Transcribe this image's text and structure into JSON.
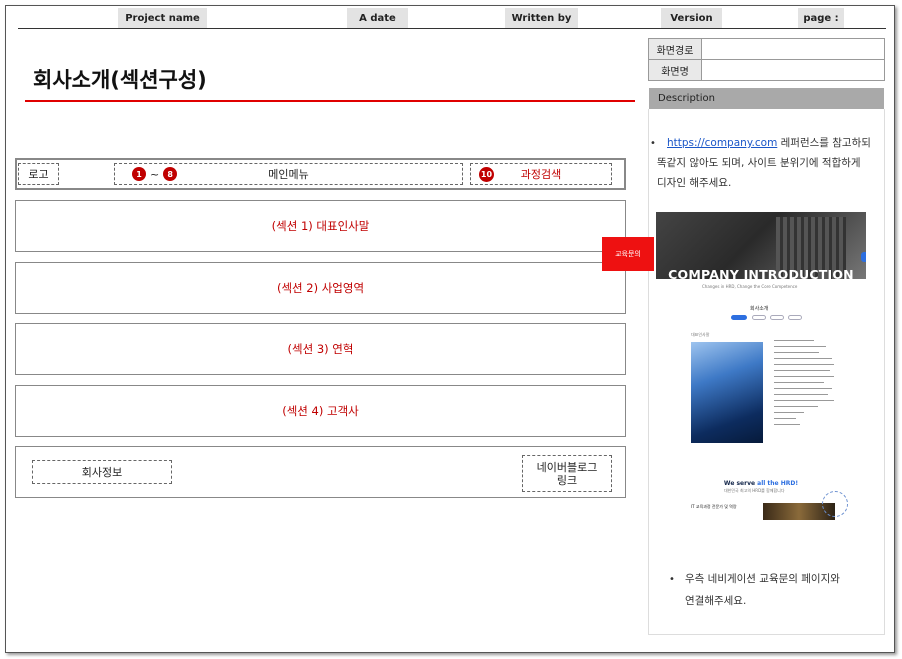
{
  "header": {
    "project_name": "Project name",
    "a_date": "A date",
    "written_by": "Written by",
    "version": "Version",
    "page": "page :"
  },
  "page_title": "회사소개(섹션구성)",
  "info": {
    "path_label": "화면경로",
    "name_label": "화면명",
    "path_value": "",
    "name_value": ""
  },
  "description": {
    "heading": "Description",
    "link": "https://company.com",
    "text_line1": " 레퍼런스를 참고하되",
    "text_line2": "똑같지 않아도 되며, 사이트 분위기에 적합하게",
    "text_line3": "디자인 해주세요.",
    "note_line1": "우측 네비게이션 교육문의 페이지와",
    "note_line2": "연결해주세요."
  },
  "wireframe": {
    "logo": "로고",
    "num_start": "1",
    "tilde": "~",
    "num_end": "8",
    "main_menu": "메인메뉴",
    "num_search": "10",
    "course_search": "과정검색",
    "sections": [
      "(섹션 1) 대표인사말",
      "(섹션 2) 사업영역",
      "(섹션 3) 연혁",
      "(섹션 4) 고객사"
    ],
    "company_info": "회사정보",
    "naver_blog_line1": "네이버블로그",
    "naver_blog_line2": "링크",
    "floating_button": "교육문의"
  },
  "reference_shot": {
    "hero_title": "COMPANY INTRODUCTION",
    "hero_sub": "Changes in HRD, Change the Core Competence",
    "page_heading": "회사소개",
    "section_label": "대표인사말",
    "serve_text": "We serve ",
    "serve_highlight": "all the HRD!",
    "serve_sub": "대한민국 최고의 HRD를 함께합니다",
    "bottom_label": "IT 교육과정 전문가 및 역량"
  },
  "colors": {
    "accent_red": "#c00000",
    "title_line": "#e00000",
    "float_button": "#ee1111",
    "header_label_bg": "#e3e3e3",
    "desc_head_bg": "#a9a9a9"
  }
}
